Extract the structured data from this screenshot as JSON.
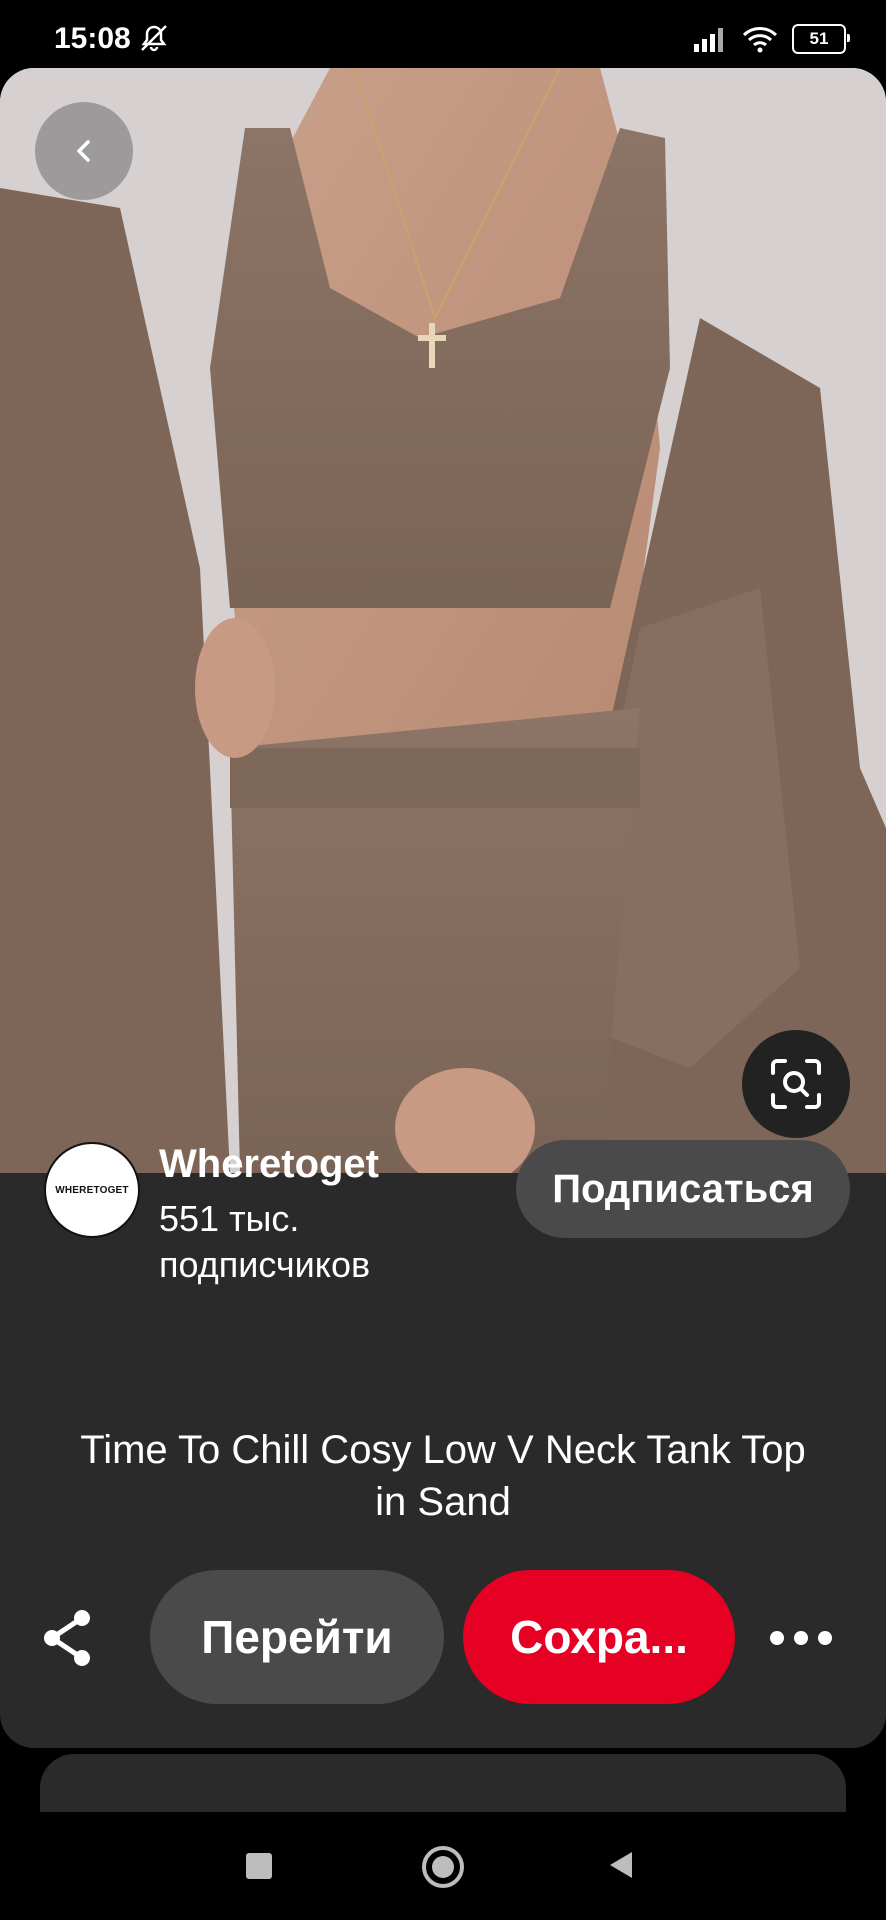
{
  "status_bar": {
    "time": "15:08",
    "battery": "51"
  },
  "pin": {
    "creator": {
      "avatar_text": "WHERETOGET",
      "name": "Wheretoget",
      "followers": "551 тыс. подписчиков"
    },
    "follow_label": "Подписаться",
    "title": "Time To Chill Cosy Low V Neck Tank Top in Sand",
    "actions": {
      "go_label": "Перейти",
      "save_label": "Сохра..."
    }
  },
  "colors": {
    "save": "#e60023",
    "card": "#2a2a2a",
    "pill": "#4a4a4a"
  },
  "icons": [
    "mute-icon",
    "signal-icon",
    "wifi-icon",
    "battery-icon",
    "back-arrow-icon",
    "visual-search-icon",
    "share-icon",
    "more-icon",
    "nav-recents-icon",
    "nav-home-icon",
    "nav-back-icon"
  ]
}
